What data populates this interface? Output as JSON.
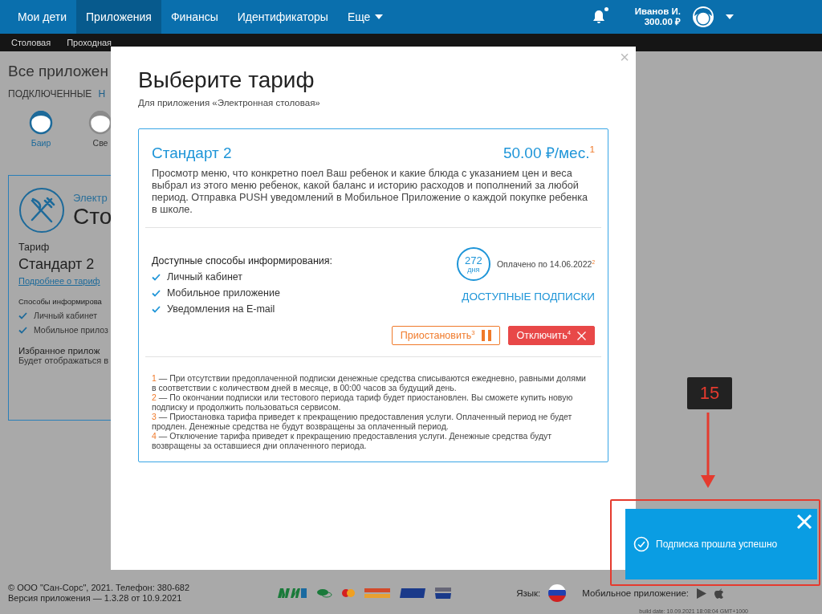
{
  "nav": {
    "items": [
      {
        "label": "Мои дети",
        "selected": false
      },
      {
        "label": "Приложения",
        "selected": true
      },
      {
        "label": "Финансы",
        "selected": false
      },
      {
        "label": "Идентификаторы",
        "selected": false
      },
      {
        "label": "Еще",
        "selected": false,
        "kind": "dropdown"
      }
    ],
    "notifications": {
      "unread": true
    },
    "user": {
      "name": "Иванов И.",
      "balance": "300.00 ₽"
    }
  },
  "subnav": {
    "items": [
      "Столовая",
      "Проходная"
    ]
  },
  "page": {
    "title": "Все приложен",
    "filters": [
      "ПОДКЛЮЧЕННЫЕ",
      "Н"
    ],
    "children": [
      {
        "name": "Баир",
        "selected": true
      },
      {
        "name": "Све",
        "selected": false
      }
    ],
    "app_card": {
      "category": "Электр",
      "name": "Сто",
      "tariff_label": "Тариф",
      "tariff": "Стандарт 2",
      "details_link": "Подробнее о тариф",
      "methods_label": "Способы информирова",
      "methods": [
        "Личный кабинет",
        "Мобильное прилоз"
      ],
      "favorite_title": "Избранное прилож",
      "favorite_note": "Будет отображаться в"
    }
  },
  "footer": {
    "copyright": "© ООО \"Сан-Сорс\", 2021. Телефон: 380-682",
    "version": "Версия приложения — 1.3.28 от 10.9.2021",
    "language_label": "Язык:",
    "mobile_label": "Мобильное приложение:",
    "build_date": "build date: 10.09.2021 18:08:04 GMT+1000"
  },
  "modal": {
    "close": "×",
    "title": "Выберите тариф",
    "subtitle": "Для приложения «Электронная столовая»",
    "tariff": {
      "name": "Стандарт 2",
      "price": "50.00 ₽/мес.$^{1}$",
      "description": "Просмотр меню, что конкретно поел Ваш ребенок и какие блюда с указанием цен и веса выбрал из этого меню ребенок, какой баланс и историю расходов и пополнений за любой период. Отправка PUSH уведомлений в Мобильное Приложение о каждой покупке ребенка в школе.",
      "methods_title": "Доступные способы информирования:",
      "methods": [
        "Личный кабинет",
        "Мобильное приложение",
        "Уведомления на E-mail"
      ],
      "days": "272",
      "days_unit": "дня",
      "paid_until": "Оплачено по 14.06.2022$^{2}$",
      "subscriptions_link": "ДОСТУПНЫЕ ПОДПИСКИ",
      "buttons": [
        {
          "label": "Приостановить$^{3}$",
          "kind": "pause"
        },
        {
          "label": "Отключить$^{4}$",
          "kind": "disable"
        }
      ],
      "notes": [
        {
          "mark": "1",
          "text": " — При отсутствии предоплаченной подписки денежные средства списываются ежедневно, равными долями в соответствии с количеством дней в месяце, в 00:00 часов за будущий день."
        },
        {
          "mark": "2",
          "text": " — По окончании подписки или тестового периода тариф будет приостановлен. Вы сможете купить новую подписку и продолжить пользоваться сервисом."
        },
        {
          "mark": "3",
          "text": " — Приостановка тарифа приведет к прекращению предоставления услуги. Оплаченный период не будет продлен. Денежные средства не будут возвращены за оплаченный период."
        },
        {
          "mark": "4",
          "text": " — Отключение тарифа приведет к прекращению предоставления услуги. Денежные средства будут возвращены за оставшиеся дни оплаченного периода."
        }
      ]
    }
  },
  "toast": {
    "message": "Подписка прошла успешно"
  },
  "annotation": {
    "label": "15"
  }
}
